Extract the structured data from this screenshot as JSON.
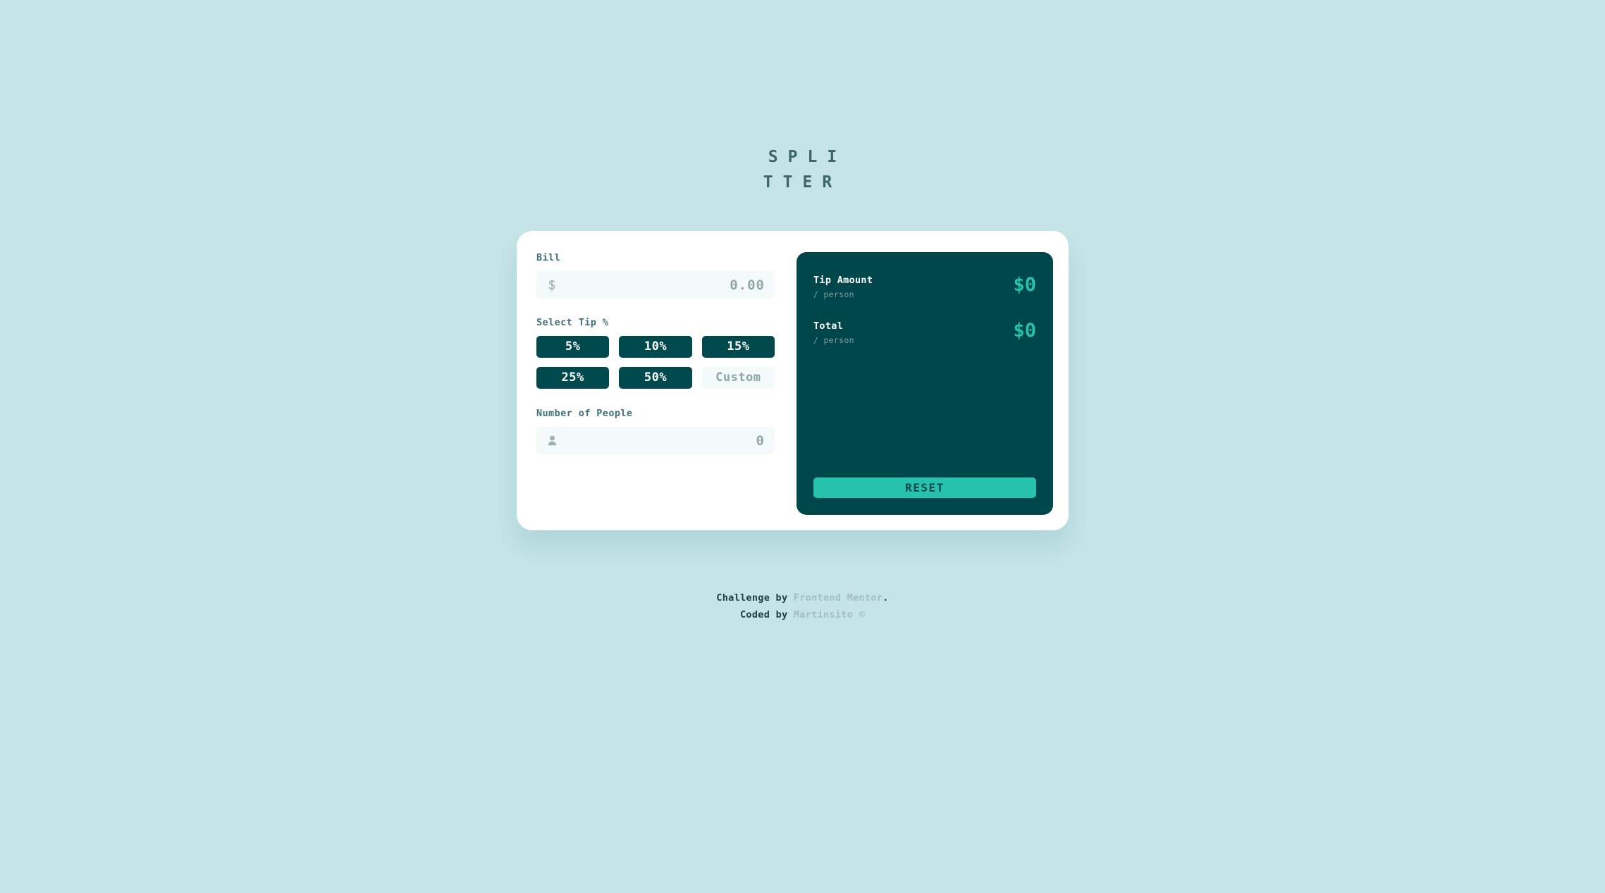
{
  "app": {
    "logo_text": "SPLITTER",
    "background_color": "#c5e4e7",
    "card_background": "#ffffff",
    "panel_background": "#00474b",
    "accent_color": "#26c2ad",
    "dark_teal": "#00494d"
  },
  "bill": {
    "label": "Bill",
    "icon": "dollar-icon",
    "value": "0.00"
  },
  "tip": {
    "label": "Select Tip %",
    "options": [
      {
        "label": "5%",
        "value": 5
      },
      {
        "label": "10%",
        "value": 10
      },
      {
        "label": "15%",
        "value": 15
      },
      {
        "label": "25%",
        "value": 25
      },
      {
        "label": "50%",
        "value": 50
      }
    ],
    "custom_placeholder": "Custom",
    "custom_value": ""
  },
  "people": {
    "label": "Number of People",
    "icon": "person-icon",
    "value": "0"
  },
  "results": {
    "rows": [
      {
        "name": "Tip Amount",
        "sub": "/ person",
        "value": "$0"
      },
      {
        "name": "Total",
        "sub": "/ person",
        "value": "$0"
      }
    ],
    "reset_label": "RESET"
  },
  "footer": {
    "line1_prefix": "Challenge by ",
    "line1_link": "Frontend Mentor",
    "line1_suffix": ".",
    "line2_prefix": "Coded by ",
    "line2_link": "Martinsito",
    "line2_suffix": " ©"
  }
}
